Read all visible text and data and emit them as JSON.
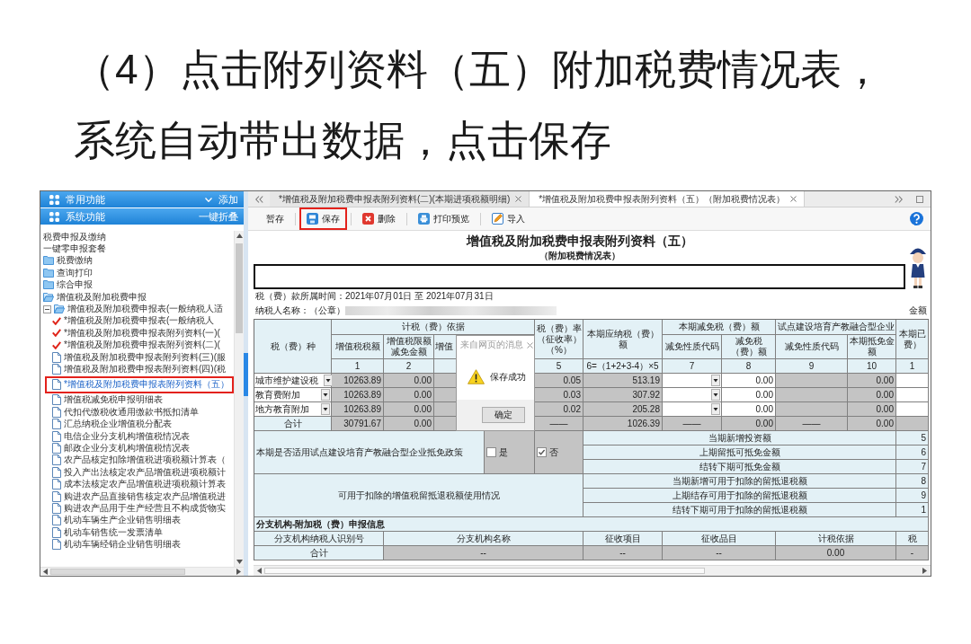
{
  "heading": {
    "lines": [
      "（4）点击附列资料（五）附加税费情况表，",
      "系统自动带出数据，点击保存"
    ]
  },
  "sidebar": {
    "panels": [
      {
        "title": "常用功能",
        "action": "添加",
        "expanded": false
      },
      {
        "title": "系统功能",
        "action": "一键折叠",
        "expanded": true
      }
    ],
    "tree": [
      {
        "label": "税费申报及缴纳",
        "kind": "text",
        "selected": false
      },
      {
        "label": "一键零申报套餐",
        "kind": "text",
        "selected": false
      },
      {
        "label": "税费缴纳",
        "kind": "folder",
        "expanded": false,
        "selected": false
      },
      {
        "label": "查询打印",
        "kind": "folder",
        "expanded": false,
        "selected": false
      },
      {
        "label": "综合申报",
        "kind": "folder",
        "expanded": false,
        "selected": false
      },
      {
        "label": "增值税及附加税费申报",
        "kind": "folder",
        "expanded": true,
        "selected": false,
        "children": [
          {
            "label": "增值税及附加税费申报表(一般纳税人适",
            "kind": "folder",
            "expanded": true,
            "selected": false,
            "children": [
              {
                "label": "*增值税及附加税费申报表(一般纳税人",
                "kind": "done",
                "selected": false
              },
              {
                "label": "*增值税及附加税费申报表附列资料(一)(",
                "kind": "done",
                "selected": false
              },
              {
                "label": "*增值税及附加税费申报表附列资料(二)(",
                "kind": "done",
                "selected": false
              },
              {
                "label": "增值税及附加税费申报表附列资料(三)(服",
                "kind": "doc",
                "selected": false
              },
              {
                "label": "增值税及附加税费申报表附列资料(四)(税",
                "kind": "doc",
                "selected": false
              },
              {
                "label": "*增值税及附加税费申报表附列资料（五）",
                "kind": "doc",
                "selected": true
              },
              {
                "label": "增值税减免税申报明细表",
                "kind": "doc",
                "selected": false
              },
              {
                "label": "代扣代缴税收通用缴款书抵扣清单",
                "kind": "doc",
                "selected": false
              },
              {
                "label": "汇总纳税企业增值税分配表",
                "kind": "doc",
                "selected": false
              },
              {
                "label": "电信企业分支机构增值税情况表",
                "kind": "doc",
                "selected": false
              },
              {
                "label": "邮政企业分支机构增值税情况表",
                "kind": "doc",
                "selected": false
              },
              {
                "label": "农产品核定扣除增值税进项税额计算表（",
                "kind": "doc",
                "selected": false
              },
              {
                "label": "投入产出法核定农产品增值税进项税额计",
                "kind": "doc",
                "selected": false
              },
              {
                "label": "成本法核定农产品增值税进项税额计算表",
                "kind": "doc",
                "selected": false
              },
              {
                "label": "购进农产品直接销售核定农产品增值税进",
                "kind": "doc",
                "selected": false
              },
              {
                "label": "购进农产品用于生产经营且不构成货物实",
                "kind": "doc",
                "selected": false
              },
              {
                "label": "机动车辆生产企业销售明细表",
                "kind": "doc",
                "selected": false
              },
              {
                "label": "机动车销售统一发票清单",
                "kind": "doc",
                "selected": false
              },
              {
                "label": "机动车辆经销企业销售明细表",
                "kind": "doc",
                "selected": false
              }
            ]
          }
        ]
      }
    ]
  },
  "tabs": [
    {
      "label": "*增值税及附加税费申报表附列资料(二)(本期进项税额明细)",
      "selected": false
    },
    {
      "label": "*增值税及附加税费申报表附列资料（五）（附加税费情况表）",
      "selected": true
    }
  ],
  "toolbar": [
    {
      "label": "暂存",
      "kind": "plain",
      "highlighted": false
    },
    {
      "label": "保存",
      "kind": "save",
      "highlighted": true
    },
    {
      "label": "删除",
      "kind": "delete",
      "highlighted": false
    },
    {
      "label": "打印预览",
      "kind": "print",
      "highlighted": false
    },
    {
      "label": "导入",
      "kind": "import",
      "highlighted": false
    }
  ],
  "form": {
    "title": "增值税及附加税费申报表附列资料（五）",
    "subtitle": "（附加税费情况表）",
    "period": "税（费）款所属时间：2021年07月01日 至 2021年07月31日",
    "taxpayer_label": "纳税人名称：（公章）",
    "unit_label": "金额",
    "tax_table": {
      "groups": [
        "计税（费）依据",
        "本期减免税（费）额",
        "试点建设培育产教融合型企业"
      ],
      "columns": [
        {
          "label": "税（费）种"
        },
        {
          "label": "增值税税额",
          "number": "1"
        },
        {
          "label": "增值税限额减免金额",
          "number": "2"
        },
        {
          "label": "增值"
        },
        {
          "label": "税（费）率（征收率）（%）",
          "number": "5"
        },
        {
          "label": "本期应纳税（费）额",
          "number": "6=（1+2+3-4）×5"
        },
        {
          "label": "减免性质代码",
          "number": "7"
        },
        {
          "label": "减免税（费）额",
          "number": "8"
        },
        {
          "label": "减免性质代码",
          "number": "9"
        },
        {
          "label": "本期抵免金额",
          "number": "10"
        },
        {
          "label_lines": [
            "本期已",
            "费）"
          ],
          "number": "1"
        }
      ],
      "rows": [
        {
          "cells": [
            {
              "kind": "select",
              "value": "城市维护建设税"
            },
            {
              "kind": "readonly",
              "value": "10263.89"
            },
            {
              "kind": "readonly",
              "value": "0.00"
            },
            {
              "kind": "readonly"
            },
            {
              "kind": "readonly",
              "value": "0.05"
            },
            {
              "kind": "readonly",
              "value": "513.19"
            },
            {
              "kind": "select"
            },
            {
              "kind": "input",
              "value": "0.00"
            },
            {
              "kind": "readonly"
            },
            {
              "kind": "readonly",
              "value": "0.00"
            },
            {
              "kind": "input"
            }
          ]
        },
        {
          "cells": [
            {
              "kind": "select",
              "value": "教育费附加"
            },
            {
              "kind": "readonly",
              "value": "10263.89"
            },
            {
              "kind": "readonly",
              "value": "0.00"
            },
            {
              "kind": "readonly"
            },
            {
              "kind": "readonly",
              "value": "0.03"
            },
            {
              "kind": "readonly",
              "value": "307.92"
            },
            {
              "kind": "select"
            },
            {
              "kind": "input",
              "value": "0.00"
            },
            {
              "kind": "readonly"
            },
            {
              "kind": "readonly",
              "value": "0.00"
            },
            {
              "kind": "input"
            }
          ]
        },
        {
          "cells": [
            {
              "kind": "select",
              "value": "地方教育附加"
            },
            {
              "kind": "readonly",
              "value": "10263.89"
            },
            {
              "kind": "readonly",
              "value": "0.00"
            },
            {
              "kind": "readonly"
            },
            {
              "kind": "readonly",
              "value": "0.02"
            },
            {
              "kind": "readonly",
              "value": "205.28"
            },
            {
              "kind": "select"
            },
            {
              "kind": "input",
              "value": "0.00"
            },
            {
              "kind": "readonly"
            },
            {
              "kind": "readonly",
              "value": "0.00"
            },
            {
              "kind": "input"
            }
          ]
        },
        {
          "cells": [
            {
              "kind": "label",
              "value": "合计"
            },
            {
              "kind": "readonly",
              "value": "30791.67"
            },
            {
              "kind": "readonly",
              "value": "0.00"
            },
            {
              "kind": "readonly"
            },
            {
              "kind": "na",
              "value": "——"
            },
            {
              "kind": "readonly",
              "value": "1026.39"
            },
            {
              "kind": "na",
              "value": "——"
            },
            {
              "kind": "readonly",
              "value": "0.00"
            },
            {
              "kind": "na",
              "value": "——"
            },
            {
              "kind": "readonly",
              "value": "0.00"
            },
            {
              "kind": "readonly"
            }
          ]
        }
      ]
    },
    "policy": {
      "label": "本期是否适用试点建设培育产教融合型企业抵免政策",
      "options": [
        {
          "label": "是",
          "checked": false
        },
        {
          "label": "否",
          "checked": true
        }
      ],
      "items": [
        {
          "label": "当期新增投资额",
          "number": "5"
        },
        {
          "label": "上期留抵可抵免金额",
          "number": "6"
        },
        {
          "label": "结转下期可抵免金额",
          "number": "7"
        }
      ]
    },
    "retained": {
      "label": "可用于扣除的增值税留抵退税额使用情况",
      "items": [
        {
          "label": "当期新增可用于扣除的留抵退税额",
          "number": "8"
        },
        {
          "label": "上期结存可用于扣除的留抵退税额",
          "number": "9"
        },
        {
          "label": "结转下期可用于扣除的留抵退税额",
          "number": "1"
        }
      ]
    },
    "branch": {
      "title": "分支机构-附加税（费）申报信息",
      "columns": [
        "分支机构纳税人识别号",
        "分支机构名称",
        "征收项目",
        "征收品目",
        "计税依据",
        "税"
      ],
      "total": [
        "合计",
        "--",
        "--",
        "--",
        "0.00",
        "-"
      ]
    }
  },
  "dialog": {
    "title": "来自网页的消息",
    "message": "保存成功",
    "button": "确定"
  }
}
